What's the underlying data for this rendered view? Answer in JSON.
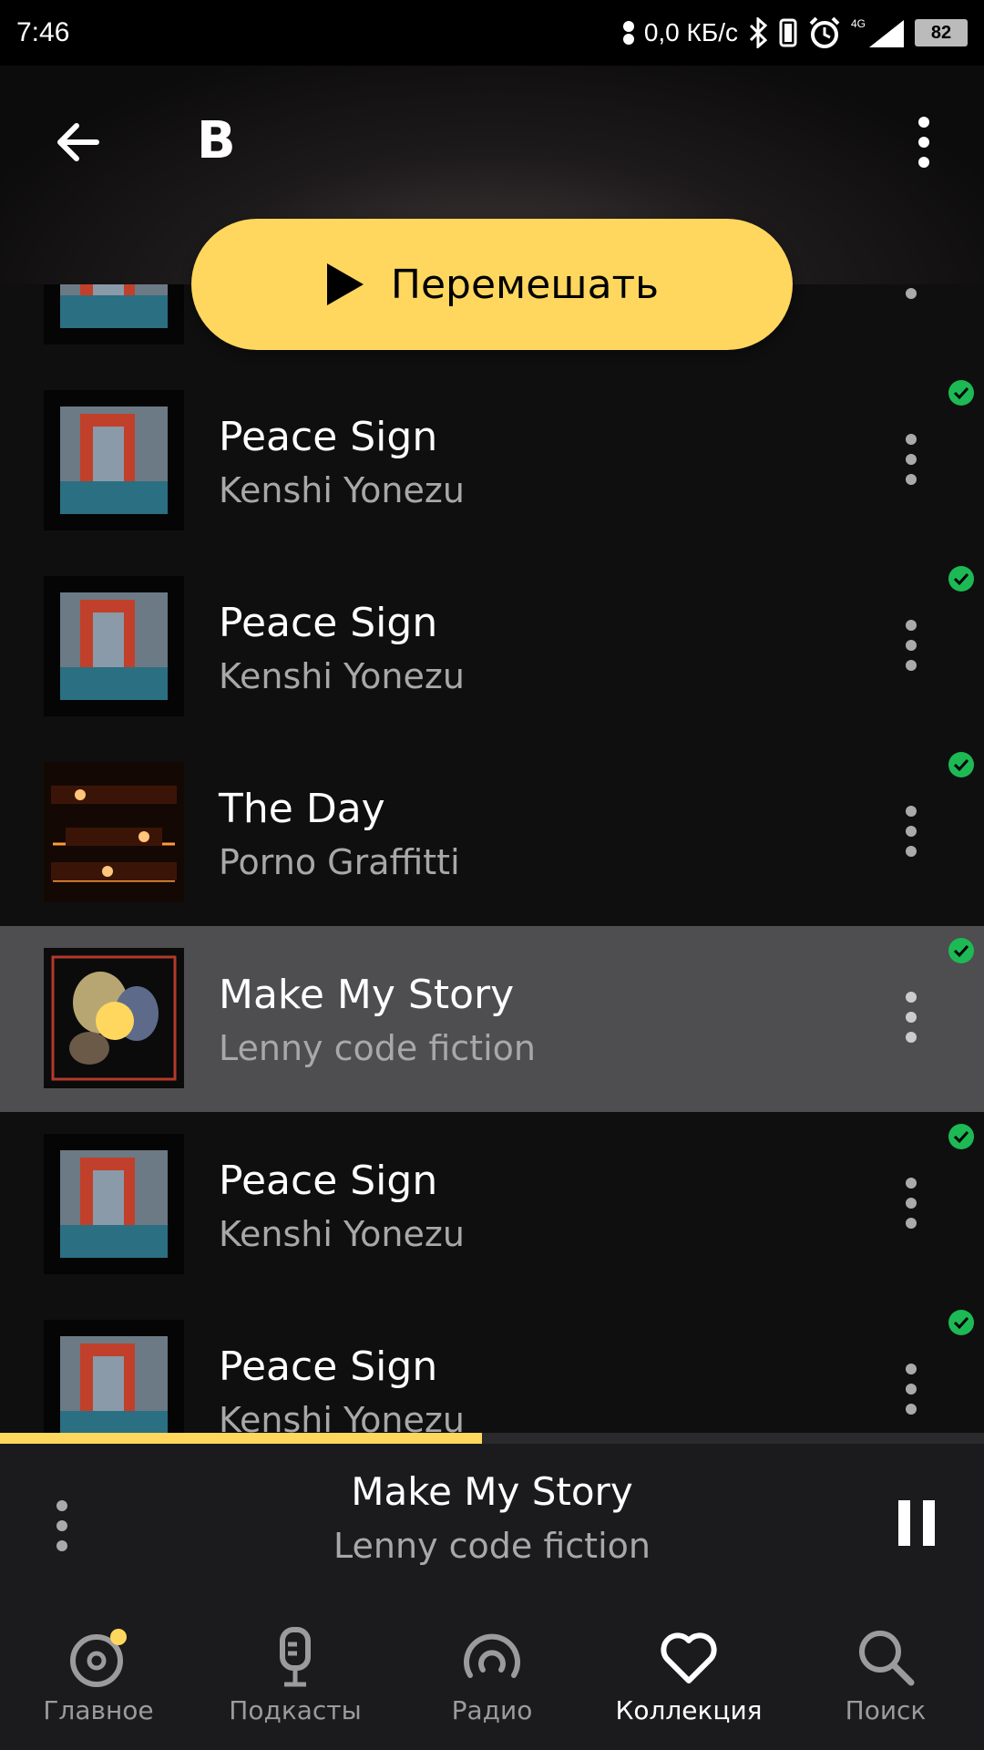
{
  "status_bar": {
    "time": "7:46",
    "network_speed": "0,0 КБ/с",
    "network_type": "4G",
    "battery": "82"
  },
  "header": {
    "title": "B"
  },
  "shuffle_button": {
    "label": "Перемешать"
  },
  "tracks": [
    {
      "title": "Peace Sign",
      "artist": "Kenshi Yonezu",
      "cover": "bootleg",
      "downloaded": true
    },
    {
      "title": "Peace Sign",
      "artist": "Kenshi Yonezu",
      "cover": "bootleg",
      "downloaded": true
    },
    {
      "title": "The Day",
      "artist": "Porno Graffitti",
      "cover": "butterfly-effect",
      "downloaded": true
    },
    {
      "title": "Make My Story",
      "artist": "Lenny code fiction",
      "cover": "make-my-story",
      "downloaded": true,
      "playing": true
    },
    {
      "title": "Peace Sign",
      "artist": "Kenshi Yonezu",
      "cover": "bootleg",
      "downloaded": true
    },
    {
      "title": "Peace Sign",
      "artist": "Kenshi Yonezu",
      "cover": "bootleg",
      "downloaded": true
    }
  ],
  "player": {
    "title": "Make My Story",
    "artist": "Lenny code fiction",
    "progress": 0.49
  },
  "tabs": [
    {
      "label": "Главное",
      "icon": "home-disc-icon",
      "selected": false
    },
    {
      "label": "Подкасты",
      "icon": "microphone-icon",
      "selected": false
    },
    {
      "label": "Радио",
      "icon": "radio-icon",
      "selected": false
    },
    {
      "label": "Коллекция",
      "icon": "heart-icon",
      "selected": true
    },
    {
      "label": "Поиск",
      "icon": "search-icon",
      "selected": false
    }
  ],
  "colors": {
    "accent": "#ffd75e",
    "active_row": "#4e4d50",
    "download_check": "#1db954"
  }
}
